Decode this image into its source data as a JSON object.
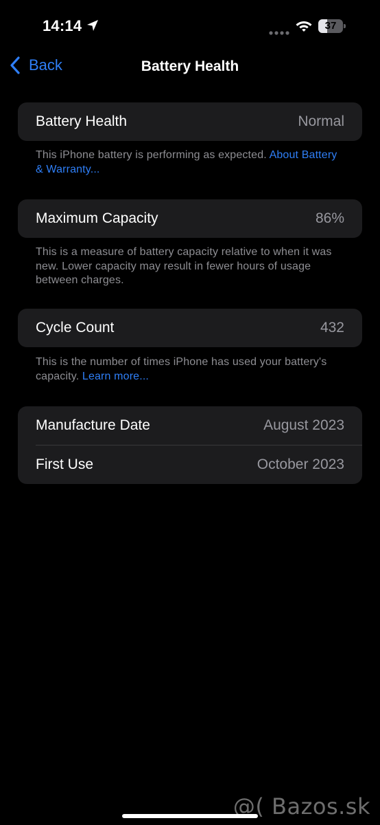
{
  "status_bar": {
    "time": "14:14",
    "battery_level": "37",
    "battery_fraction": 0.37,
    "icons": [
      "location-arrow-icon",
      "signal-dots-icon",
      "wifi-icon",
      "battery-icon"
    ]
  },
  "nav": {
    "back_label": "Back",
    "title": "Battery Health",
    "accent_color": "#2f7ff7"
  },
  "battery_health": {
    "label": "Battery Health",
    "value": "Normal",
    "footnote_text": "This iPhone battery is performing as expected. ",
    "footnote_link": "About Battery & Warranty..."
  },
  "maximum_capacity": {
    "label": "Maximum Capacity",
    "value": "86%",
    "footnote_text": "This is a measure of battery capacity relative to when it was new. Lower capacity may result in fewer hours of usage between charges."
  },
  "cycle_count": {
    "label": "Cycle Count",
    "value": "432",
    "footnote_text": "This is the number of times iPhone has used your battery's capacity. ",
    "footnote_link": "Learn more..."
  },
  "dates": {
    "manufacture_label": "Manufacture Date",
    "manufacture_value": "August 2023",
    "first_use_label": "First Use",
    "first_use_value": "October 2023"
  },
  "watermark": "@( Bazos.sk"
}
